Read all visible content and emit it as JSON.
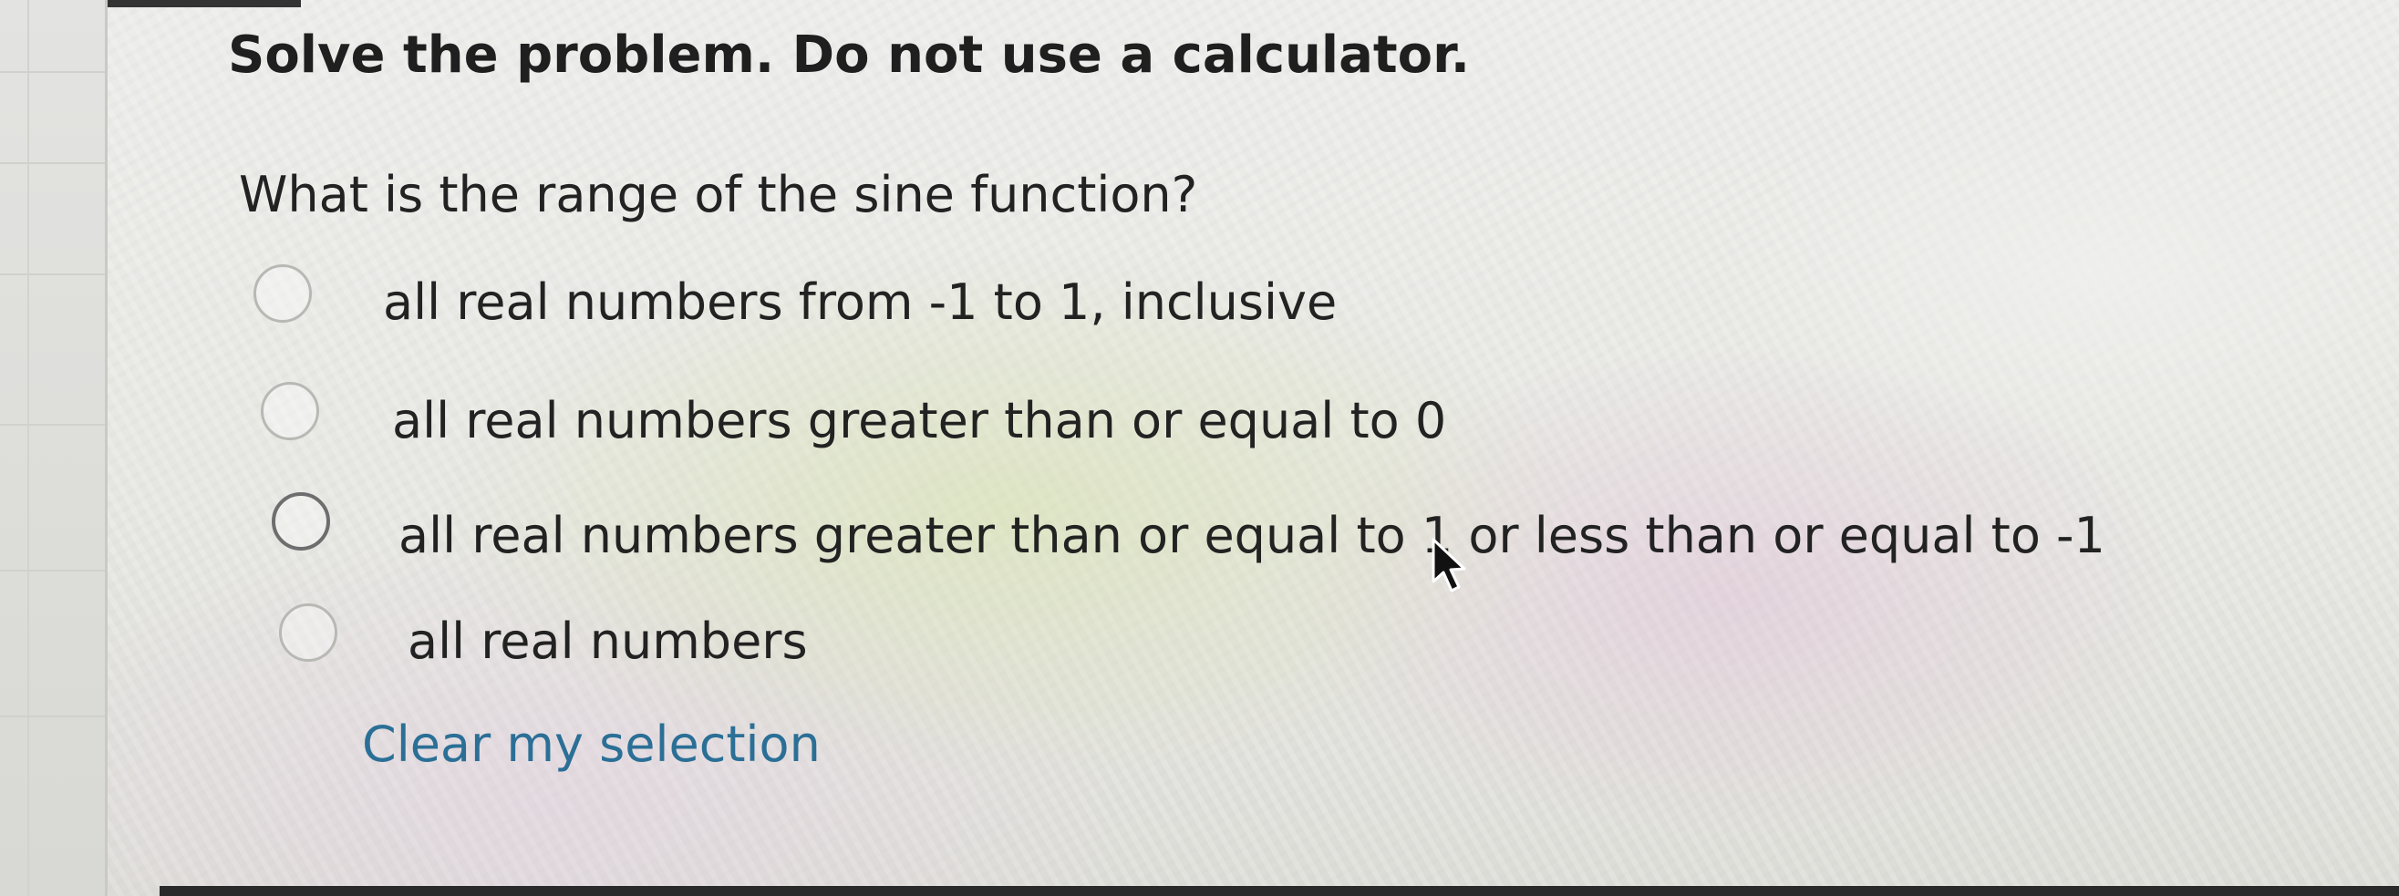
{
  "instruction": "Solve the problem. Do not use a calculator.",
  "question": "What is the range of the sine function?",
  "options": [
    {
      "label": "all real numbers from -1 to 1, inclusive",
      "selected": false
    },
    {
      "label": "all real numbers greater than or equal to 0",
      "selected": false
    },
    {
      "label": "all real numbers greater than or equal to 1 or less than or equal to -1",
      "selected": false
    },
    {
      "label": "all real numbers",
      "selected": false
    }
  ],
  "clear_selection_label": "Clear my selection",
  "colors": {
    "link": "#2b6f96",
    "text": "#222222"
  },
  "icons": {
    "cursor": "mouse-pointer-icon",
    "radio": "radio-button-icon"
  }
}
